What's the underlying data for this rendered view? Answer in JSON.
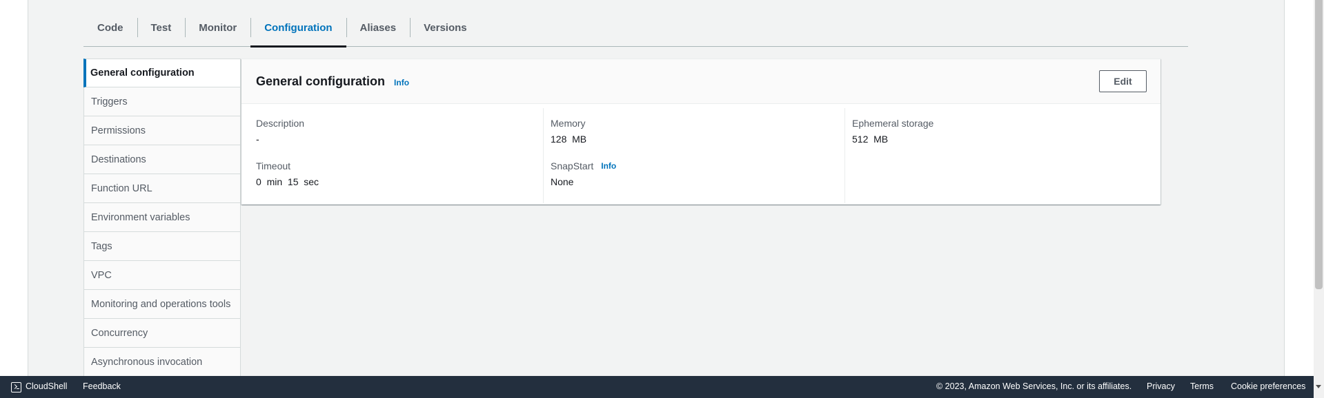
{
  "tabs": [
    {
      "label": "Code"
    },
    {
      "label": "Test"
    },
    {
      "label": "Monitor"
    },
    {
      "label": "Configuration",
      "active": true
    },
    {
      "label": "Aliases"
    },
    {
      "label": "Versions"
    }
  ],
  "sidebar": {
    "items": [
      {
        "label": "General configuration",
        "active": true
      },
      {
        "label": "Triggers"
      },
      {
        "label": "Permissions"
      },
      {
        "label": "Destinations"
      },
      {
        "label": "Function URL"
      },
      {
        "label": "Environment variables"
      },
      {
        "label": "Tags"
      },
      {
        "label": "VPC"
      },
      {
        "label": "Monitoring and operations tools"
      },
      {
        "label": "Concurrency"
      },
      {
        "label": "Asynchronous invocation"
      }
    ]
  },
  "panel": {
    "title": "General configuration",
    "info": "Info",
    "edit_label": "Edit",
    "description": {
      "label": "Description",
      "value": "-"
    },
    "timeout": {
      "label": "Timeout",
      "value": "0  min  15  sec"
    },
    "memory": {
      "label": "Memory",
      "value": "128  MB"
    },
    "snapstart": {
      "label": "SnapStart",
      "info": "Info",
      "value": "None"
    },
    "ephemeral": {
      "label": "Ephemeral storage",
      "value": "512  MB"
    }
  },
  "footer": {
    "cloudshell": "CloudShell",
    "feedback": "Feedback",
    "copyright": "© 2023, Amazon Web Services, Inc. or its affiliates.",
    "privacy": "Privacy",
    "terms": "Terms",
    "cookies": "Cookie preferences"
  },
  "colors": {
    "accent": "#0073bb",
    "footer_bg": "#232f3e",
    "page_bg": "#f2f3f3"
  }
}
